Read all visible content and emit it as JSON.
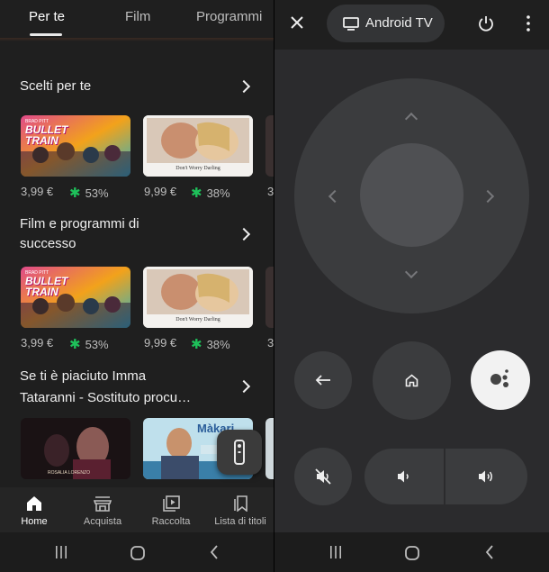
{
  "tabs": [
    "Per te",
    "Film",
    "Programmi"
  ],
  "sections": [
    {
      "title_lines": [
        "Scelti per te"
      ],
      "items": [
        {
          "poster_title": "BULLET TRAIN",
          "poster_top": "BRAD PITT",
          "price": "3,99 €",
          "score": "53%"
        },
        {
          "poster_title": "Don't Worry Darling",
          "price": "9,99 €",
          "score": "38%"
        }
      ],
      "peek": "3"
    },
    {
      "title_lines": [
        "Film e programmi di",
        "successo"
      ],
      "items": [
        {
          "poster_title": "BULLET TRAIN",
          "poster_top": "BRAD PITT",
          "price": "3,99 €",
          "score": "53%"
        },
        {
          "poster_title": "Don't Worry Darling",
          "price": "9,99 €",
          "score": "38%"
        }
      ],
      "peek": "3"
    },
    {
      "title_lines": [
        "Se ti è piaciuto Imma",
        "Tataranni - Sostituto procu…"
      ],
      "items": [
        {
          "poster_title": "ROSALIA LORENZO"
        },
        {
          "poster_title": "Màkari"
        }
      ]
    }
  ],
  "bottom_nav": [
    {
      "label": "Home",
      "icon": "home-icon",
      "active": true
    },
    {
      "label": "Acquista",
      "icon": "store-icon",
      "active": false
    },
    {
      "label": "Raccolta",
      "icon": "library-icon",
      "active": false
    },
    {
      "label": "Lista di titoli",
      "icon": "bookmark-icon",
      "active": false
    }
  ],
  "remote": {
    "device_name": "Android TV"
  },
  "colors": {
    "accent_green": "#1ec15a",
    "background": "#1f1f1f",
    "remote_panel": "#2b2b2d"
  }
}
